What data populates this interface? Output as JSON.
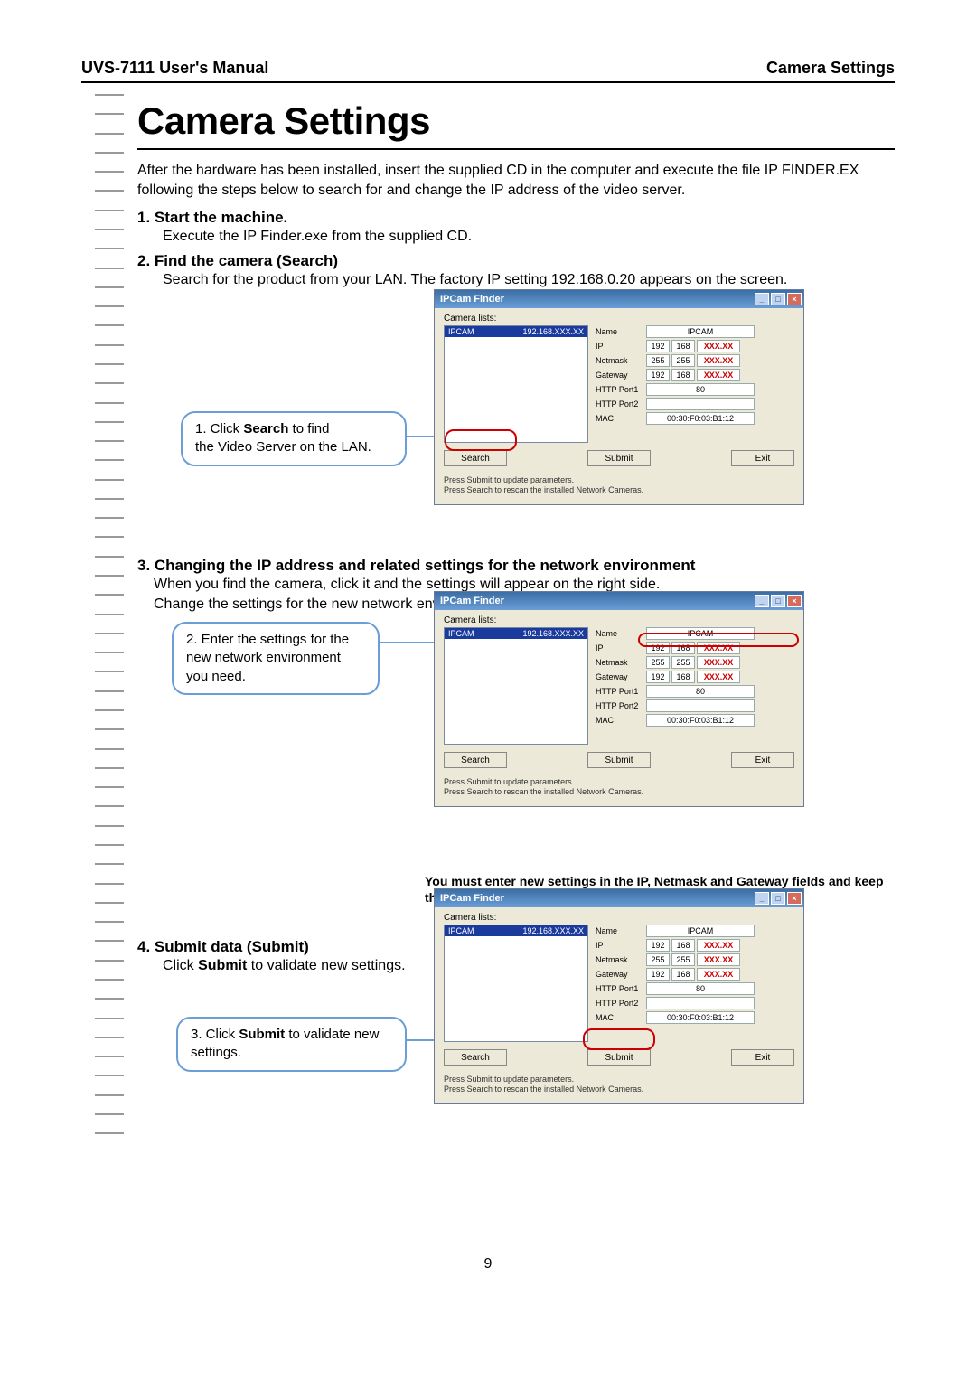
{
  "header": {
    "left": "UVS-7111 User's Manual",
    "right": "Camera Settings"
  },
  "title": "Camera Settings",
  "intro": "After the hardware has been installed, insert the supplied CD in the computer and execute the file IP FINDER.EX following the steps below to search for and change the IP address of the video server.",
  "step1": {
    "heading": "1. Start the machine.",
    "body": "Execute the IP Finder.exe from the supplied CD."
  },
  "step2": {
    "heading": "2. Find the camera (Search)",
    "body": "Search for the product from your LAN. The factory IP setting 192.168.0.20 appears on the screen."
  },
  "callout1": {
    "prefix": "1. Click ",
    "bold": "Search",
    "suffix": " to find",
    "line2": "the Video Server on the LAN."
  },
  "step3": {
    "heading": "3. Changing the IP address and related settings for the network environment",
    "body1": "When you find the camera, click it and the settings will appear on the right side.",
    "body2": "Change the settings for the new network environment you need."
  },
  "callout2": {
    "line1": "2. Enter the settings for the",
    "line2": "new network environment",
    "line3": "you need."
  },
  "note": "You must enter new settings in the IP, Netmask and Gateway fields and keep the settigs in other fields unchanged.",
  "step4": {
    "heading": "4. Submit data (Submit)",
    "body_prefix": "Click ",
    "body_bold": "Submit",
    "body_suffix": " to validate new settings."
  },
  "callout3": {
    "prefix": "3. Click ",
    "bold": "Submit",
    "suffix": " to validate new",
    "line2": "settings."
  },
  "finder": {
    "title": "IPCam Finder",
    "camlist_label": "Camera lists:",
    "row_name": "IPCAM",
    "row_ip": "192.168.XXX.XX",
    "labels": {
      "name": "Name",
      "ip": "IP",
      "netmask": "Netmask",
      "gateway": "Gateway",
      "http1": "HTTP Port1",
      "http2": "HTTP Port2",
      "mac": "MAC"
    },
    "vals": {
      "name": "IPCAM",
      "ip": [
        "192",
        "168",
        "XXX.XX"
      ],
      "netmask": [
        "255",
        "255",
        "XXX.XX"
      ],
      "gateway": [
        "192",
        "168",
        "XXX.XX"
      ],
      "http1": "80",
      "mac": "00:30:F0:03:B1:12"
    },
    "buttons": {
      "search": "Search",
      "submit": "Submit",
      "exit": "Exit"
    },
    "hint1": "Press Submit to update parameters.",
    "hint2": "Press Search to rescan the installed Network Cameras."
  },
  "page_number": "9"
}
